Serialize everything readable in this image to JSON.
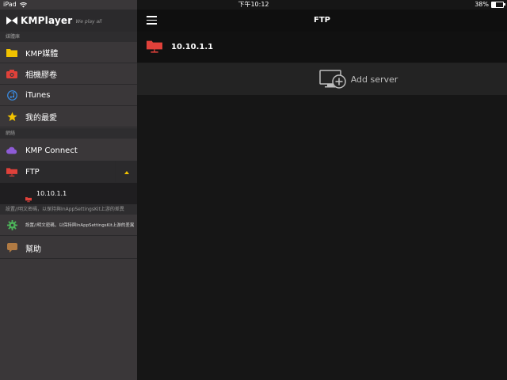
{
  "status_bar": {
    "carrier": "iPad",
    "time": "下午10:12",
    "battery": "38%",
    "battery_level": 0.38
  },
  "brand": {
    "name": "KMPlayer",
    "tagline": "We play all"
  },
  "sidebar": {
    "sections": [
      {
        "header": "媒體庫"
      },
      {
        "header": "網絡"
      },
      {
        "header": "設置//明文密碼，以保持與InAppSettingsKit上游的差異"
      }
    ],
    "media_items": [
      {
        "label": "KMP媒體",
        "icon": "folder-icon"
      },
      {
        "label": "相機膠卷",
        "icon": "camera-icon"
      },
      {
        "label": "iTunes",
        "icon": "music-note-icon"
      },
      {
        "label": "我的最愛",
        "icon": "star-icon"
      }
    ],
    "network_items": [
      {
        "label": "KMP Connect",
        "icon": "cloud-icon"
      },
      {
        "label": "FTP",
        "icon": "ftp-icon"
      }
    ],
    "ftp_sub_item": {
      "label": "10.10.1.1",
      "icon": "ftp-icon"
    },
    "settings_item": {
      "label": "設置//明文密碼，以保持與InAppSettingsKit上游的差異",
      "icon": "gear-icon"
    },
    "help_item": {
      "label": "幫助",
      "icon": "chat-bubble-icon"
    }
  },
  "main": {
    "title": "FTP",
    "server": {
      "label": "10.10.1.1",
      "icon": "ftp-icon"
    },
    "add_server": {
      "label": "Add server",
      "icon": "add-monitor-icon"
    }
  },
  "colors": {
    "sidebar_bg": "#3a3739",
    "main_bg": "#161616",
    "ftp_red": "#e0413a",
    "accent_yellow": "#f2c300",
    "cloud_purple": "#8e5bd6",
    "gear_green": "#4db35a",
    "itunes_blue": "#3a8ee6"
  }
}
